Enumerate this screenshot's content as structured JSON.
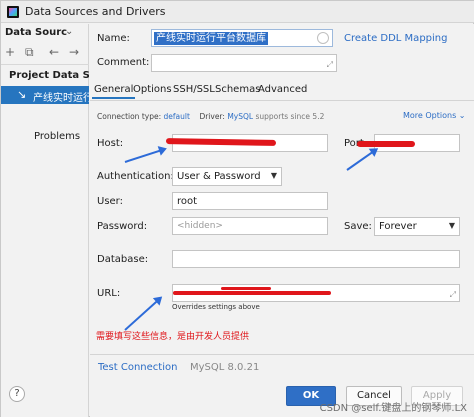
{
  "window": {
    "title": "Data Sources and Drivers"
  },
  "left_panel": {
    "title": "Data Sources",
    "tools": [
      "+",
      "⧉",
      "←",
      "→"
    ],
    "group_label": "Project Data So...",
    "selected_item": "产线实时运行",
    "problems_label": "Problems",
    "help_label": "?"
  },
  "form": {
    "name_label": "Name:",
    "name_value": "产线实时运行平台数据库",
    "create_ddl_label": "Create DDL Mapping",
    "comment_label": "Comment:",
    "tabs": [
      "General",
      "Options",
      "SSH/SSL",
      "Schemas",
      "Advanced"
    ],
    "connection_type_label": "Connection type:",
    "connection_type_value": "default",
    "driver_label": "Driver:",
    "driver_value": "MySQL",
    "driver_note": "supports since 5.2",
    "more_options_label": "More Options",
    "host_label": "Host:",
    "port_label": "Port:",
    "auth_label": "Authentication:",
    "auth_value": "User & Password",
    "user_label": "User:",
    "user_value": "root",
    "password_label": "Password:",
    "password_placeholder": "<hidden>",
    "save_label": "Save:",
    "save_value": "Forever",
    "database_label": "Database:",
    "url_label": "URL:",
    "overrides_label": "Overrides settings above",
    "annotation": "需要填写这些信息，是由开发人员提供",
    "test_connection_label": "Test Connection",
    "version_label": "MySQL 8.0.21"
  },
  "buttons": {
    "ok": "OK",
    "cancel": "Cancel",
    "apply": "Apply"
  },
  "watermark": "CSDN @self.键盘上的钢琴师.LX",
  "colors": {
    "accent": "#2675bf",
    "link": "#2b6cc4",
    "annotation": "#e0161b",
    "arrow": "#2d6bd8"
  }
}
